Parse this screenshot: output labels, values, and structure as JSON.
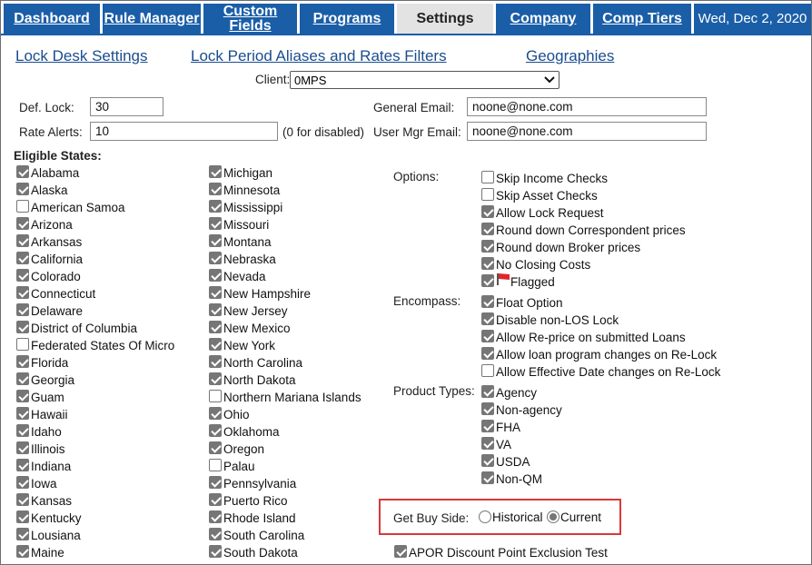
{
  "nav": {
    "tabs": [
      {
        "label": "Dashboard"
      },
      {
        "label": "Rule Manager"
      },
      {
        "label": "Custom Fields"
      },
      {
        "label": "Programs"
      },
      {
        "label": "Settings"
      },
      {
        "label": "Company"
      },
      {
        "label": "Comp Tiers"
      }
    ],
    "date": "Wed, Dec 2, 2020",
    "active_tab": "Settings",
    "tab_color": "#1a5ea8"
  },
  "links": {
    "lock_desk": "Lock Desk Settings",
    "aliases": "Lock Period Aliases and Rates Filters",
    "geographies": "Geographies"
  },
  "client": {
    "label": "Client:",
    "value": "0MPS"
  },
  "form": {
    "def_lock_label": "Def. Lock:",
    "def_lock_value": "30",
    "rate_alerts_label": "Rate Alerts:",
    "rate_alerts_value": "10",
    "rate_alerts_note": "(0 for disabled)",
    "general_email_label": "General Email:",
    "general_email_value": "noone@none.com",
    "user_mgr_email_label": "User Mgr Email:",
    "user_mgr_email_value": "noone@none.com"
  },
  "states": {
    "heading": "Eligible States:",
    "col1": [
      {
        "name": "Alabama",
        "checked": true
      },
      {
        "name": "Alaska",
        "checked": true
      },
      {
        "name": "American Samoa",
        "checked": false
      },
      {
        "name": "Arizona",
        "checked": true
      },
      {
        "name": "Arkansas",
        "checked": true
      },
      {
        "name": "California",
        "checked": true
      },
      {
        "name": "Colorado",
        "checked": true
      },
      {
        "name": "Connecticut",
        "checked": true
      },
      {
        "name": "Delaware",
        "checked": true
      },
      {
        "name": "District of Columbia",
        "checked": true
      },
      {
        "name": "Federated States Of Micro",
        "checked": false
      },
      {
        "name": "Florida",
        "checked": true
      },
      {
        "name": "Georgia",
        "checked": true
      },
      {
        "name": "Guam",
        "checked": true
      },
      {
        "name": "Hawaii",
        "checked": true
      },
      {
        "name": "Idaho",
        "checked": true
      },
      {
        "name": "Illinois",
        "checked": true
      },
      {
        "name": "Indiana",
        "checked": true
      },
      {
        "name": "Iowa",
        "checked": true
      },
      {
        "name": "Kansas",
        "checked": true
      },
      {
        "name": "Kentucky",
        "checked": true
      },
      {
        "name": "Lousiana",
        "checked": true
      },
      {
        "name": "Maine",
        "checked": true
      }
    ],
    "col2": [
      {
        "name": "Michigan",
        "checked": true
      },
      {
        "name": "Minnesota",
        "checked": true
      },
      {
        "name": "Mississippi",
        "checked": true
      },
      {
        "name": "Missouri",
        "checked": true
      },
      {
        "name": "Montana",
        "checked": true
      },
      {
        "name": "Nebraska",
        "checked": true
      },
      {
        "name": "Nevada",
        "checked": true
      },
      {
        "name": "New Hampshire",
        "checked": true
      },
      {
        "name": "New Jersey",
        "checked": true
      },
      {
        "name": "New Mexico",
        "checked": true
      },
      {
        "name": "New York",
        "checked": true
      },
      {
        "name": "North Carolina",
        "checked": true
      },
      {
        "name": "North Dakota",
        "checked": true
      },
      {
        "name": "Northern Mariana Islands",
        "checked": false
      },
      {
        "name": "Ohio",
        "checked": true
      },
      {
        "name": "Oklahoma",
        "checked": true
      },
      {
        "name": "Oregon",
        "checked": true
      },
      {
        "name": "Palau",
        "checked": false
      },
      {
        "name": "Pennsylvania",
        "checked": true
      },
      {
        "name": "Puerto Rico",
        "checked": true
      },
      {
        "name": "Rhode Island",
        "checked": true
      },
      {
        "name": "South Carolina",
        "checked": true
      },
      {
        "name": "South Dakota",
        "checked": true
      }
    ]
  },
  "options": {
    "label": "Options:",
    "items": [
      {
        "name": "Skip Income Checks",
        "checked": false
      },
      {
        "name": "Skip Asset Checks",
        "checked": false
      },
      {
        "name": "Allow Lock Request",
        "checked": true
      },
      {
        "name": "Round down Correspondent prices",
        "checked": true
      },
      {
        "name": "Round down Broker prices",
        "checked": true
      },
      {
        "name": "No Closing Costs",
        "checked": true
      },
      {
        "name": "Flagged",
        "checked": true
      }
    ]
  },
  "encompass": {
    "label": "Encompass:",
    "items": [
      {
        "name": "Float Option",
        "checked": true
      },
      {
        "name": "Disable non-LOS Lock",
        "checked": true
      },
      {
        "name": "Allow Re-price on submitted Loans",
        "checked": true
      },
      {
        "name": "Allow loan program changes on Re-Lock",
        "checked": true
      },
      {
        "name": "Allow Effective Date changes on Re-Lock",
        "checked": false
      }
    ]
  },
  "product_types": {
    "label": "Product Types:",
    "items": [
      {
        "name": "Agency",
        "checked": true
      },
      {
        "name": "Non-agency",
        "checked": true
      },
      {
        "name": "FHA",
        "checked": true
      },
      {
        "name": "VA",
        "checked": true
      },
      {
        "name": "USDA",
        "checked": true
      },
      {
        "name": "Non-QM",
        "checked": true
      }
    ]
  },
  "buy_side": {
    "label": "Get Buy Side:",
    "historical": "Historical",
    "current": "Current",
    "selected": "Current",
    "highlight_color": "#d9383b"
  },
  "apor": {
    "label": "APOR Discount Point Exclusion Test",
    "checked": true
  }
}
